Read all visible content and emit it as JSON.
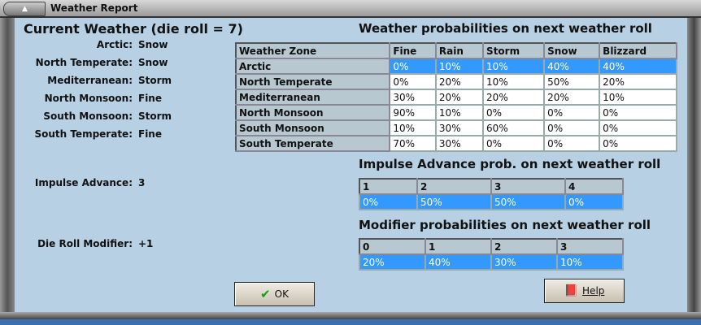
{
  "window": {
    "title": "Weather Report"
  },
  "current": {
    "heading": "Current Weather (die roll = 7)",
    "zones": [
      {
        "label": "Arctic:",
        "value": "Snow"
      },
      {
        "label": "North Temperate:",
        "value": "Snow"
      },
      {
        "label": "Mediterranean:",
        "value": "Storm"
      },
      {
        "label": "North Monsoon:",
        "value": "Fine"
      },
      {
        "label": "South Monsoon:",
        "value": "Storm"
      },
      {
        "label": "South Temperate:",
        "value": "Fine"
      }
    ],
    "impulse_label": "Impulse Advance:",
    "impulse_value": "3",
    "modifier_label": "Die Roll Modifier:",
    "modifier_value": "+1"
  },
  "weather_table": {
    "heading": "Weather probabilities on next weather roll",
    "columns": [
      "Weather Zone",
      "Fine",
      "Rain",
      "Storm",
      "Snow",
      "Blizzard"
    ],
    "rows": [
      [
        "Arctic",
        "0%",
        "10%",
        "10%",
        "40%",
        "40%"
      ],
      [
        "North Temperate",
        "0%",
        "20%",
        "10%",
        "50%",
        "20%"
      ],
      [
        "Mediterranean",
        "30%",
        "20%",
        "20%",
        "20%",
        "10%"
      ],
      [
        "North Monsoon",
        "90%",
        "10%",
        "0%",
        "0%",
        "0%"
      ],
      [
        "South Monsoon",
        "10%",
        "30%",
        "60%",
        "0%",
        "0%"
      ],
      [
        "South Temperate",
        "70%",
        "30%",
        "0%",
        "0%",
        "0%"
      ]
    ],
    "selected_row": 0
  },
  "impulse_table": {
    "heading": "Impulse Advance prob. on next weather roll",
    "columns": [
      "1",
      "2",
      "3",
      "4"
    ],
    "rows": [
      [
        "0%",
        "50%",
        "50%",
        "0%"
      ]
    ],
    "selected_row": 0
  },
  "modifier_table": {
    "heading": "Modifier probabilities on next weather roll",
    "columns": [
      "0",
      "1",
      "2",
      "3"
    ],
    "rows": [
      [
        "20%",
        "40%",
        "30%",
        "10%"
      ]
    ],
    "selected_row": 0
  },
  "buttons": {
    "ok": "OK",
    "help": "Help"
  },
  "colors": {
    "background": "#b7d0e3",
    "selection": "#3399ff",
    "header": "#b8c8d0"
  }
}
